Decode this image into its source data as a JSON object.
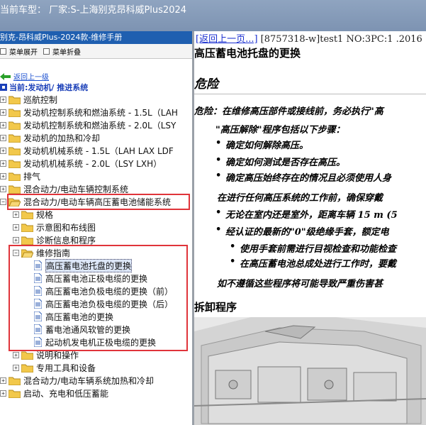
{
  "titlebar": {
    "text": "当前车型：  厂家:S-上海别克昂科威Plus2024"
  },
  "left": {
    "title": "别克-昂科威Plus-2024款-维修手册",
    "expand_all": "菜单展开",
    "collapse_all": "菜单折叠",
    "back": "返回上一级",
    "current": "当前:发动机/ 推进系统",
    "tree": [
      "巡航控制",
      "发动机控制系统和燃油系统 - 1.5L（LAH",
      "发动机控制系统和燃油系统 - 2.0L（LSY",
      "发动机的加热和冷却",
      "发动机机械系统 - 1.5L（LAH LAX LDF",
      "发动机机械系统 - 2.0L（LSY LXH）",
      "排气",
      "混合动力/电动车辆控制系统",
      "混合动力/电动车辆高压蓄电池储能系统",
      "规格",
      "示意图和布线图",
      "诊断信息和程序",
      "维修指南",
      "高压蓄电池托盘的更换",
      "高压蓄电池正极电缆的更换",
      "高压蓄电池负极电缆的更换（前）",
      "高压蓄电池负极电缆的更换（后）",
      "高压蓄电池的更换",
      "蓄电池通风软管的更换",
      "起动机发电机正极电缆的更换",
      "说明和操作",
      "专用工具和设备",
      "混合动力/电动车辆系统加热和冷却",
      "启动、充电和低压蓄能"
    ]
  },
  "right": {
    "back_link": "[返回上一页...]",
    "nav_rest": " [8757318-w]test1 NO:3PC:1 .2016",
    "heading": "高压蓄电池托盘的更换",
    "danger_title": "危险",
    "danger_text": "危险：在维修高压部件或接线前，务必执行\"高",
    "intro": "\"高压解除\"程序包括以下步骤：",
    "steps": [
      "确定如何解除高压。",
      "确定如何测试是否存在高压。",
      "确定高压始终存在的情况且必须使用人身"
    ],
    "before_work": "在进行任何高压系统的工作前，确保穿戴",
    "ppe": [
      "无论在室内还是室外，距离车辆 15 m (5",
      "经认证的最新的\"0\"级绝缘手套，额定电"
    ],
    "sub": [
      "使用手套前需进行目视检查和功能检查",
      "在高压蓄电池总成处进行工作时，要戴"
    ],
    "footer": "如不遵循这些程序将可能导致严重伤害甚",
    "section": "拆卸程序"
  }
}
